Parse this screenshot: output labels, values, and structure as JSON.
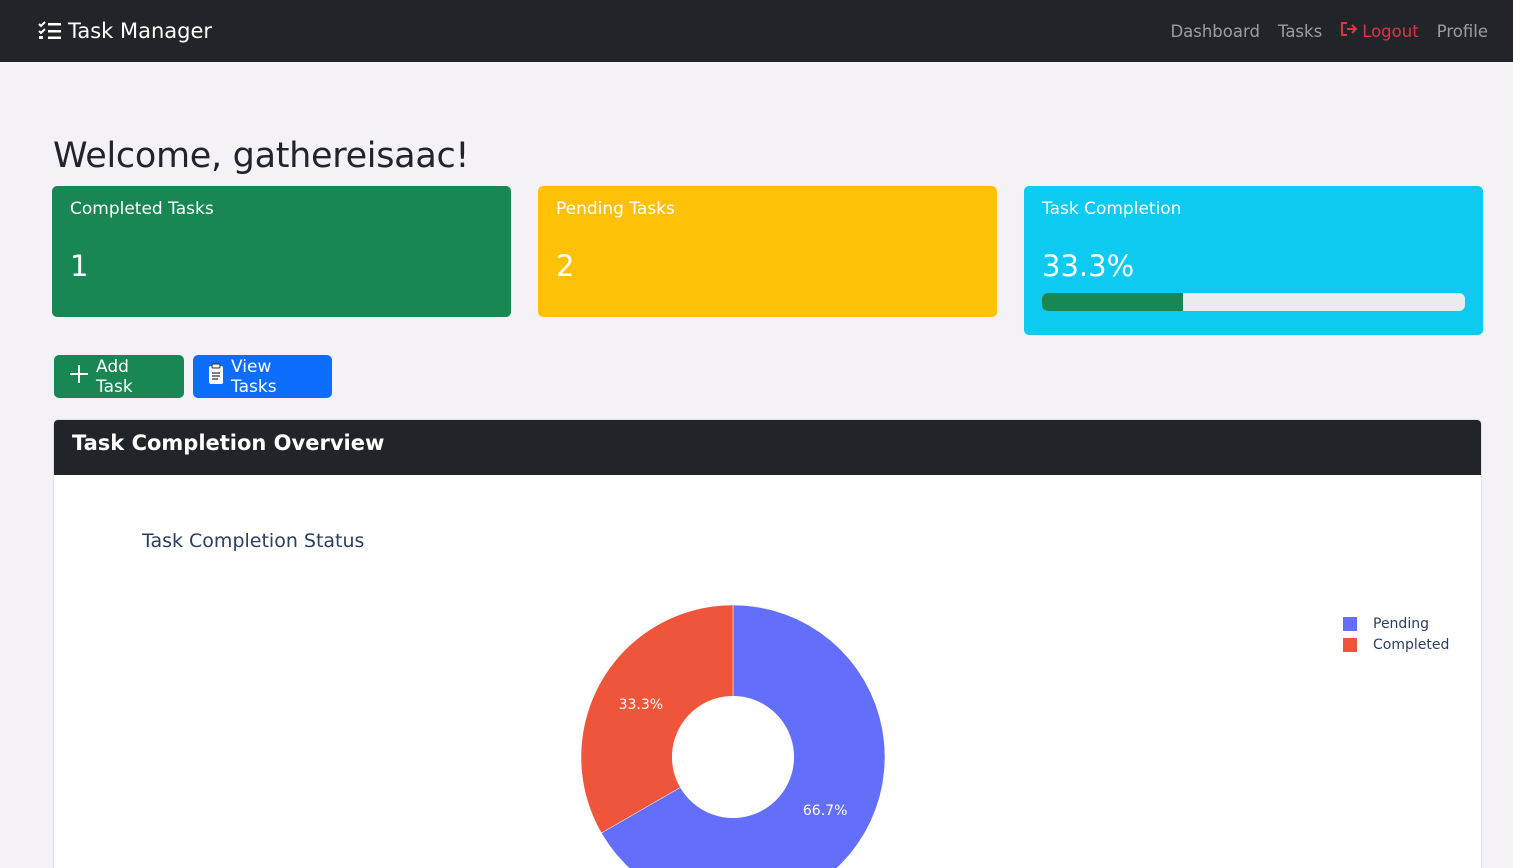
{
  "navbar": {
    "brand": "Task Manager",
    "links": {
      "dashboard": "Dashboard",
      "tasks": "Tasks",
      "logout": "Logout",
      "profile": "Profile"
    }
  },
  "welcome": "Welcome, gathereisaac!",
  "cards": {
    "completed": {
      "title": "Completed Tasks",
      "value": "1",
      "color": "#198754"
    },
    "pending": {
      "title": "Pending Tasks",
      "value": "2",
      "color": "#ffc107"
    },
    "completion": {
      "title": "Task Completion",
      "value": "33.3%",
      "progress": 0.333,
      "color": "#0dcaf0"
    }
  },
  "buttons": {
    "add_task": "Add Task",
    "view_tasks": "View Tasks"
  },
  "overview": {
    "header": "Task Completion Overview"
  },
  "chart_data": {
    "type": "pie",
    "hole": 0.4,
    "title": "Task Completion Status",
    "categories": [
      "Pending",
      "Completed"
    ],
    "values": [
      2,
      1
    ],
    "labels": [
      "66.7%",
      "33.3%"
    ],
    "colors": [
      "#636efa",
      "#ef553b"
    ],
    "legend": "top-right"
  }
}
